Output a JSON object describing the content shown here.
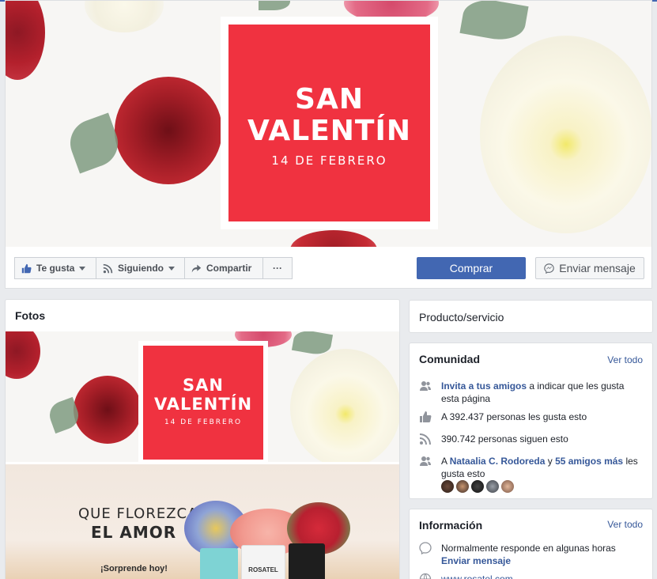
{
  "cover": {
    "title_line1": "SAN",
    "title_line2": "VALENTÍN",
    "subtitle": "14 DE FEBRERO"
  },
  "actions": {
    "like": "Te gusta",
    "following": "Siguiendo",
    "share": "Compartir",
    "more": "···",
    "buy": "Comprar",
    "message": "Enviar mensaje"
  },
  "photos": {
    "title": "Fotos",
    "photo1": {
      "title_line1": "SAN",
      "title_line2": "VALENTÍN",
      "subtitle": "14 DE FEBRERO"
    },
    "photo2": {
      "line1": "QUE FLOREZCA",
      "line2": "EL AMOR",
      "tagline": "¡Sorprende hoy!",
      "brand": "ROSATEL"
    }
  },
  "category": {
    "label": "Producto/servicio"
  },
  "community": {
    "title": "Comunidad",
    "see_all": "Ver todo",
    "invite_link": "Invita a tus amigos",
    "invite_text": " a indicar que les gusta esta página",
    "likes_text": "A 392.437 personas les gusta esto",
    "follows_text": "390.742 personas siguen esto",
    "friends_prefix": "A ",
    "friend_name": "Nataalia C. Rodoreda",
    "friends_mid": " y ",
    "friends_more": "55 amigos más",
    "friends_suffix": " les gusta esto"
  },
  "info": {
    "title": "Información",
    "see_all": "Ver todo",
    "response_text": "Normalmente responde en algunas horas",
    "send_message": "Enviar mensaje",
    "website": "www.rosatel.com"
  },
  "colors": {
    "brand_red": "#f03240",
    "fb_blue": "#4267b2",
    "link_blue": "#365899"
  }
}
